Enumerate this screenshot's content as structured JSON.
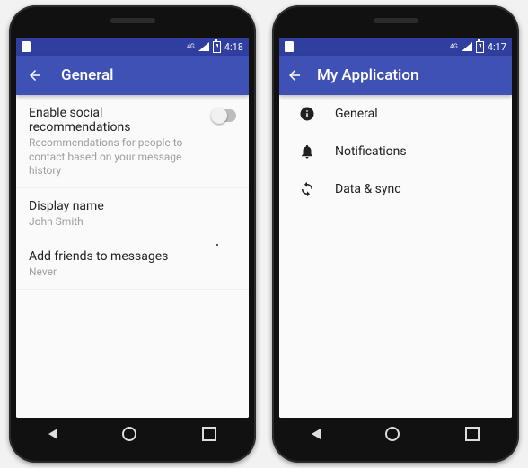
{
  "left": {
    "status": {
      "time": "4:18",
      "net": "4G"
    },
    "appbar": {
      "title": "General"
    },
    "prefs": [
      {
        "title": "Enable social recommendations",
        "summary": "Recommendations for people to contact based on your message history",
        "switch": true
      },
      {
        "title": "Display name",
        "summary": "John Smith"
      },
      {
        "title": "Add friends to messages",
        "summary": "Never"
      }
    ]
  },
  "right": {
    "status": {
      "time": "4:17",
      "net": "4G"
    },
    "appbar": {
      "title": "My Application"
    },
    "headers": [
      {
        "icon": "info",
        "label": "General"
      },
      {
        "icon": "bell",
        "label": "Notifications"
      },
      {
        "icon": "sync",
        "label": "Data & sync"
      }
    ]
  }
}
